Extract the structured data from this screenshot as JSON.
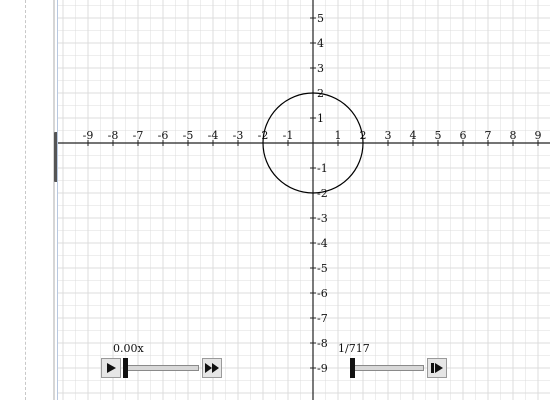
{
  "graph": {
    "x_axis_range": [
      -10,
      10
    ],
    "y_axis_range": [
      -10,
      6
    ],
    "x_tick_labels": [
      "-9",
      "-8",
      "-7",
      "-6",
      "-5",
      "-4",
      "-3",
      "-2",
      "-1",
      "1",
      "2",
      "3",
      "4",
      "5",
      "6",
      "7",
      "8",
      "9"
    ],
    "y_tick_labels": [
      "5",
      "4",
      "3",
      "2",
      "1",
      "-1",
      "-2",
      "-3",
      "-4",
      "-5",
      "-6",
      "-7",
      "-8",
      "-9"
    ],
    "grid": "on",
    "shapes": [
      {
        "kind": "circle",
        "center": [
          0,
          0
        ],
        "radius": 2,
        "color": "#000000"
      }
    ],
    "colors": {
      "grid": "#dcdcdc",
      "axis": "#222222",
      "curve": "#000000"
    }
  },
  "speed_control": {
    "readout": "0.00x",
    "play_icon": "play-icon",
    "fast_forward_icon": "fast-forward-icon",
    "slider_value": 0
  },
  "step_control": {
    "readout": "1/717",
    "current_step": 1,
    "total_steps": 717,
    "step_icon": "step-forward-icon"
  }
}
